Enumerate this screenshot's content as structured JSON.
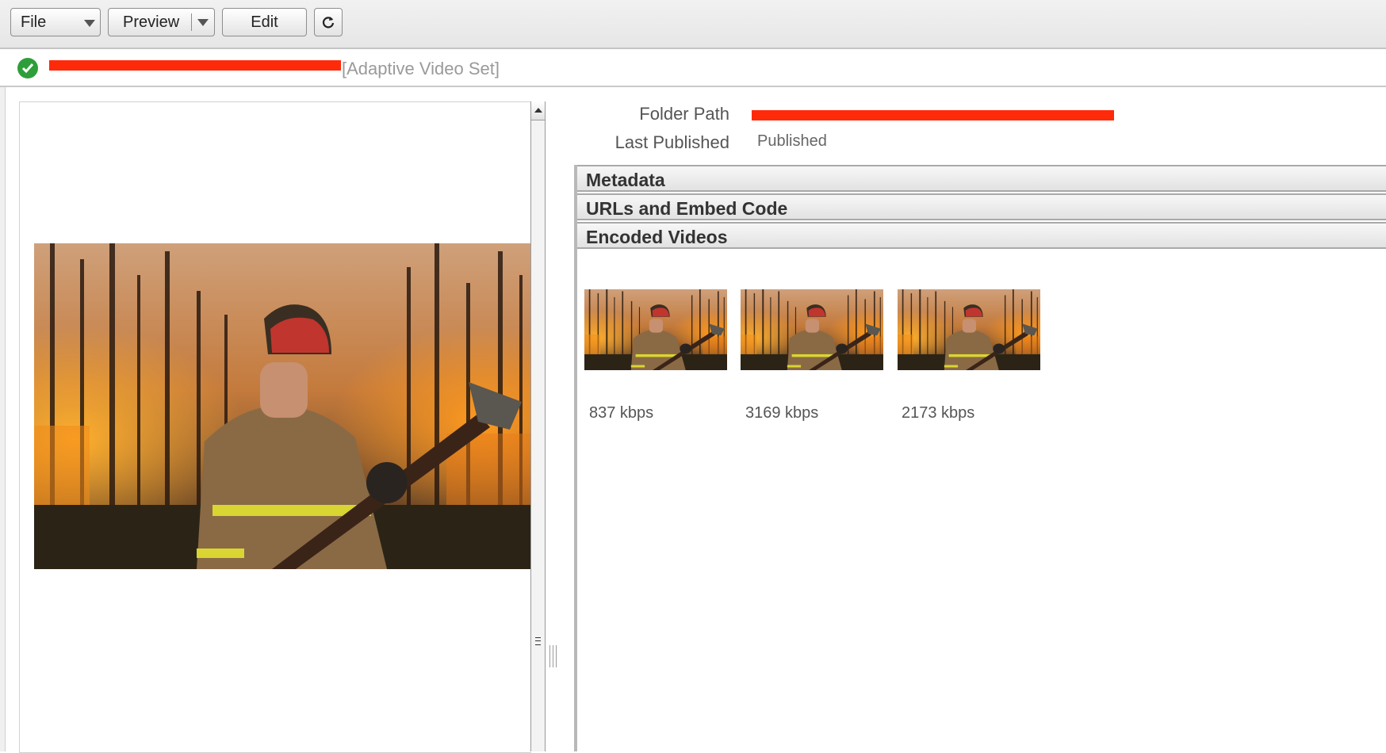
{
  "toolbar": {
    "file_label": "File",
    "preview_label": "Preview",
    "edit_label": "Edit",
    "refresh_icon": "refresh-icon"
  },
  "asset": {
    "status_icon": "check-circle-icon",
    "type_label": "[Adaptive Video Set]"
  },
  "properties": {
    "folder_path_label": "Folder Path",
    "last_published_label": "Last Published",
    "last_published_value": "Published"
  },
  "accordion": {
    "sections": [
      {
        "label": "Metadata"
      },
      {
        "label": "URLs and Embed Code"
      },
      {
        "label": "Encoded Videos"
      }
    ]
  },
  "encoded_videos": [
    {
      "bitrate": "837 kbps"
    },
    {
      "bitrate": "3169 kbps"
    },
    {
      "bitrate": "2173 kbps"
    }
  ],
  "colors": {
    "redaction": "#ff2a0a",
    "status_ok": "#2e9e3a"
  }
}
